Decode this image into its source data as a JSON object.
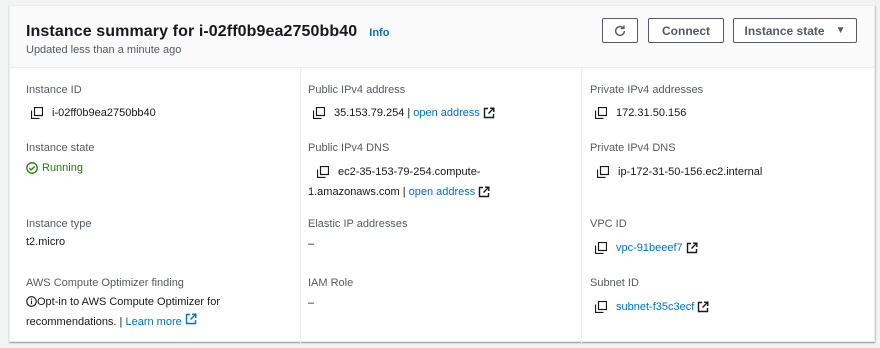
{
  "header": {
    "title": "Instance summary for i-02ff0b9ea2750bb40",
    "info": "Info",
    "subtitle": "Updated less than a minute ago",
    "connect": "Connect",
    "instance_state": "Instance state"
  },
  "fields": {
    "instance_id": {
      "label": "Instance ID",
      "value": "i-02ff0b9ea2750bb40"
    },
    "public_ipv4": {
      "label": "Public IPv4 address",
      "value": "35.153.79.254 |",
      "link": "open address"
    },
    "private_ipv4": {
      "label": "Private IPv4 addresses",
      "value": "172.31.50.156"
    },
    "instance_state": {
      "label": "Instance state",
      "value": "Running"
    },
    "public_dns": {
      "label": "Public IPv4 DNS",
      "value_line1": "ec2-35-153-79-254.compute-",
      "value_line2": "1.amazonaws.com |",
      "link": "open address"
    },
    "private_dns": {
      "label": "Private IPv4 DNS",
      "value": "ip-172-31-50-156.ec2.internal"
    },
    "instance_type": {
      "label": "Instance type",
      "value": "t2.micro"
    },
    "elastic_ip": {
      "label": "Elastic IP addresses",
      "value": "–"
    },
    "vpc_id": {
      "label": "VPC ID",
      "value": "vpc-91beeef7"
    },
    "optimizer": {
      "label": "AWS Compute Optimizer finding",
      "line1": "Opt-in to AWS Compute Optimizer for",
      "line2": "recommendations. |",
      "link": "Learn more"
    },
    "iam_role": {
      "label": "IAM Role",
      "value": "–"
    },
    "subnet_id": {
      "label": "Subnet ID",
      "value": "subnet-f35c3ecf"
    }
  },
  "colors": {
    "link": "#0073bb",
    "running": "#1d8102",
    "label": "#545b64",
    "text": "#16191f"
  },
  "icons": [
    "refresh-icon",
    "caret-down-icon",
    "copy-icon",
    "external-link-icon",
    "status-check-icon",
    "info-circle-icon"
  ]
}
